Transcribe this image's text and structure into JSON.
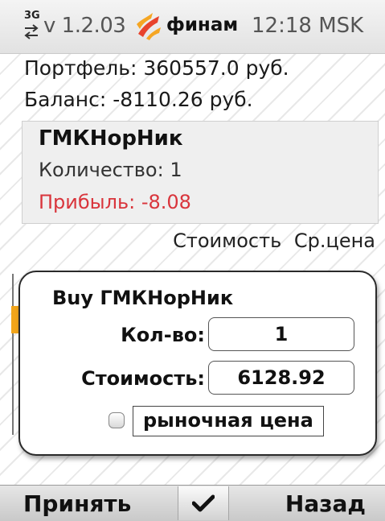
{
  "status_bar": {
    "network": "3G",
    "version": "v 1.2.03",
    "brand": "финам",
    "time": "12:18 MSK",
    "logo_icon": "finam-logo-icon",
    "brand_colors": [
      "#e8432c",
      "#f5a623"
    ]
  },
  "account": {
    "portfolio": "Портфель: 360557.0 руб.",
    "balance": "Баланс: -8110.26 руб."
  },
  "position": {
    "name": "ГМКНорНик",
    "quantity": "Количество: 1",
    "profit": "Прибыль: -8.08",
    "profit_color": "#d9353c"
  },
  "columns": [
    "Стоимость",
    "Ср.цена"
  ],
  "dialog": {
    "title": "Buy ГМКНорНик",
    "qty_label": "Кол-во:",
    "qty_value": "1",
    "cost_label": "Стоимость:",
    "cost_value": "6128.92",
    "market_price_label": "рыночная цена",
    "market_price_checked": false
  },
  "softkeys": {
    "left": "Принять",
    "center_icon": "checkmark-icon",
    "right": "Назад"
  }
}
